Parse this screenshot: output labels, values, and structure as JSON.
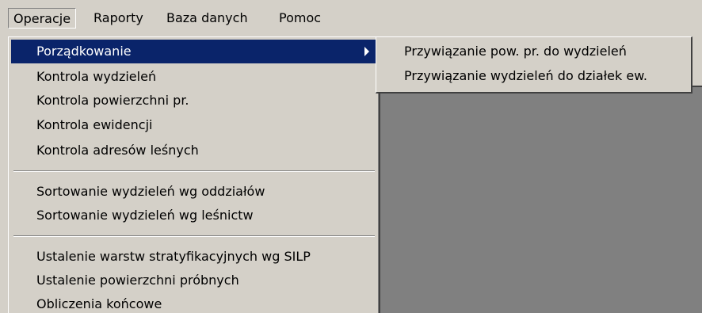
{
  "menubar": {
    "items": [
      {
        "label": "Operacje"
      },
      {
        "label": "Raporty"
      },
      {
        "label": "Baza danych"
      },
      {
        "label": "Pomoc"
      }
    ]
  },
  "operacje_menu": {
    "items": [
      {
        "label": "Porządkowanie"
      },
      {
        "label": "Kontrola wydzieleń"
      },
      {
        "label": "Kontrola powierzchni pr."
      },
      {
        "label": "Kontrola ewidencji"
      },
      {
        "label": "Kontrola adresów leśnych"
      },
      {
        "label": "Sortowanie wydzieleń wg oddziałów"
      },
      {
        "label": "Sortowanie wydzieleń wg leśnictw"
      },
      {
        "label": "Ustalenie warstw stratyfikacyjnych wg SILP"
      },
      {
        "label": "Ustalenie powierzchni próbnych"
      },
      {
        "label": "Obliczenia końcowe"
      }
    ]
  },
  "porzadkowanie_submenu": {
    "items": [
      {
        "label": "Przywiązanie pow. pr. do wydzieleń"
      },
      {
        "label": "Przywiązanie wydzieleń do działek ew."
      }
    ]
  },
  "colors": {
    "menu_bg": "#d4d0c8",
    "highlight_bg": "#0a246a",
    "highlight_fg": "#ffffff",
    "workspace_bg": "#808080"
  }
}
